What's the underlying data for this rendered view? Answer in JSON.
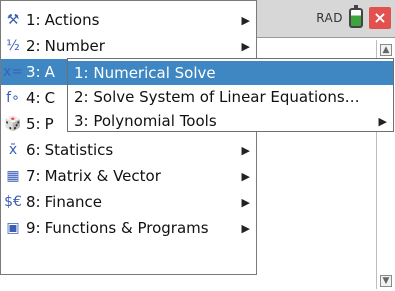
{
  "status": {
    "mode": "RAD",
    "close_symbol": "×"
  },
  "menu": {
    "items": [
      {
        "num": "1:",
        "label": "Actions",
        "icon": "tools-icon",
        "glyph": "⚒"
      },
      {
        "num": "2:",
        "label": "Number",
        "icon": "number-icon",
        "glyph": "½"
      },
      {
        "num": "3:",
        "label": "A",
        "icon": "algebra-icon",
        "glyph": "x="
      },
      {
        "num": "4:",
        "label": "C",
        "icon": "calculus-icon",
        "glyph": "f∘"
      },
      {
        "num": "5:",
        "label": "P",
        "icon": "probability-icon",
        "glyph": "🎲"
      },
      {
        "num": "6:",
        "label": "Statistics",
        "icon": "statistics-icon",
        "glyph": "x̄"
      },
      {
        "num": "7:",
        "label": "Matrix & Vector",
        "icon": "matrix-icon",
        "glyph": "▦"
      },
      {
        "num": "8:",
        "label": "Finance",
        "icon": "finance-icon",
        "glyph": "$€"
      },
      {
        "num": "9:",
        "label": "Functions & Programs",
        "icon": "functions-icon",
        "glyph": "▣"
      }
    ]
  },
  "submenu": {
    "items": [
      {
        "label": "1: Numerical Solve"
      },
      {
        "label": "2: Solve System of Linear Equations…"
      },
      {
        "label": "3: Polynomial Tools"
      }
    ]
  },
  "colors": {
    "highlight": "#3f87c2",
    "header": "#d7d7d7",
    "close": "#e35050",
    "battery_green": "#3ea43e"
  }
}
